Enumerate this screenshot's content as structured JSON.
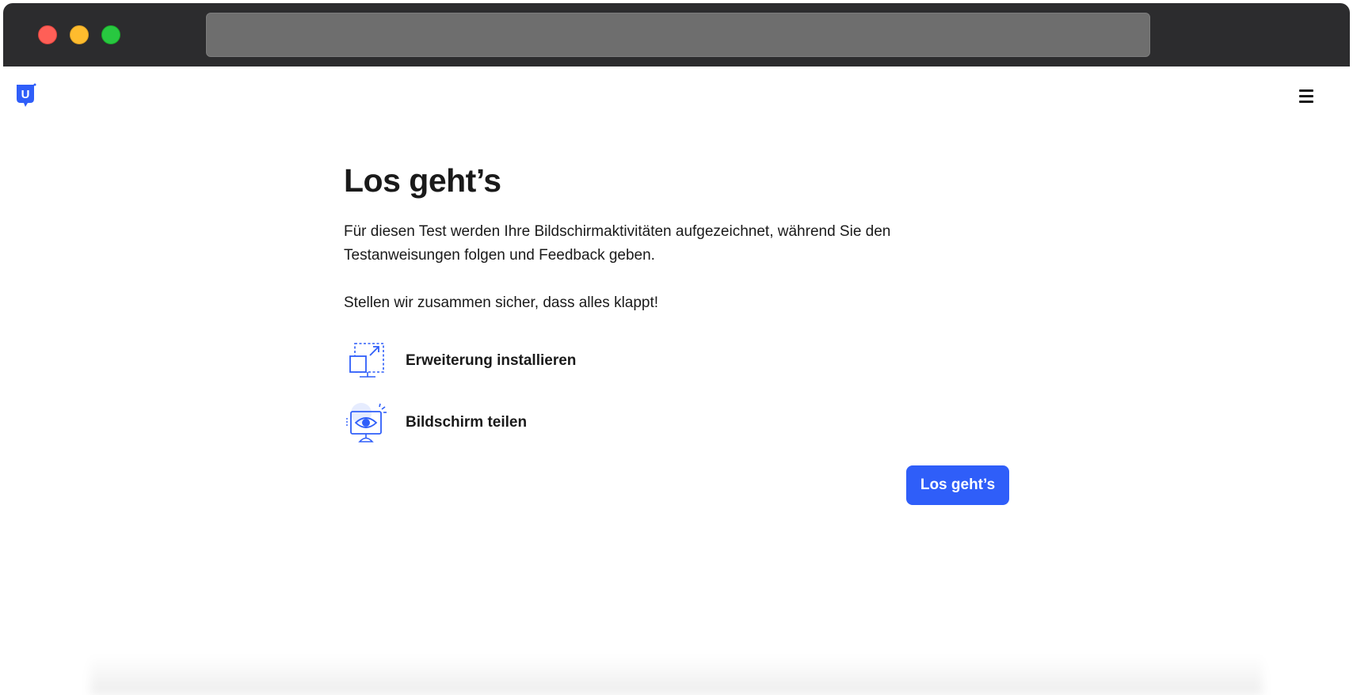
{
  "browser": {
    "url": ""
  },
  "header": {
    "logo_letter": "U",
    "menu_icon": "hamburger-menu-icon"
  },
  "main": {
    "title": "Los geht’s",
    "intro": "Für diesen Test werden Ihre Bildschirmaktivitäten aufgezeichnet, während Sie den Testanweisungen folgen und Feedback geben.",
    "intro2": "Stellen wir zusammen sicher, dass alles klappt!",
    "steps": [
      {
        "icon": "extension-install-icon",
        "label": "Erweiterung installieren"
      },
      {
        "icon": "screen-share-eye-icon",
        "label": "Bildschirm teilen"
      }
    ],
    "start_button": "Los geht’s"
  },
  "colors": {
    "accent": "#2f5ef9",
    "titlebar": "#2c2c2e",
    "urlbar": "#6e6e6e"
  }
}
